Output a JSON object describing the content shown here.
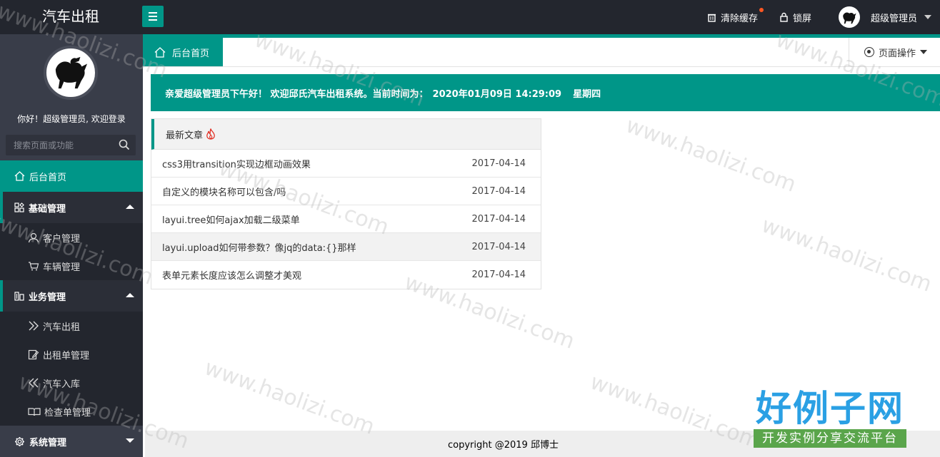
{
  "header": {
    "logo": "汽车出租",
    "clear_cache": "清除缓存",
    "lock_screen": "锁屏",
    "user_name": "超级管理员"
  },
  "sidebar": {
    "greeting": "你好！超级管理员, 欢迎登录",
    "search_placeholder": "搜索页面或功能",
    "home": "后台首页",
    "groups": [
      {
        "label": "基础管理",
        "items": [
          "客户管理",
          "车辆管理"
        ]
      },
      {
        "label": "业务管理",
        "items": [
          "汽车出租",
          "出租单管理",
          "汽车入库",
          "检查单管理"
        ]
      },
      {
        "label": "系统管理"
      }
    ]
  },
  "tabs": {
    "home": "后台首页",
    "page_ops": "页面操作"
  },
  "welcome": {
    "text": "亲爱超级管理员下午好！ 欢迎邱氏汽车出租系统。当前时间为：",
    "time": "2020年01月09日 14:29:09",
    "weekday": "星期四"
  },
  "articles": {
    "title": "最新文章",
    "items": [
      {
        "title": "css3用transition实现边框动画效果",
        "date": "2017-04-14"
      },
      {
        "title": "自定义的模块名称可以包含/吗",
        "date": "2017-04-14"
      },
      {
        "title": "layui.tree如何ajax加载二级菜单",
        "date": "2017-04-14"
      },
      {
        "title": "layui.upload如何带参数？像jq的data:{}那样",
        "date": "2017-04-14"
      },
      {
        "title": "表单元素长度应该怎么调整才美观",
        "date": "2017-04-14"
      }
    ]
  },
  "footer": {
    "copyright": "copyright @2019 邱博士"
  },
  "watermark": {
    "text": "www.haolizi.com",
    "brand_title": "好例子网",
    "brand_sub": "开发实例分享交流平台"
  },
  "colors": {
    "accent": "#009688",
    "topbar": "#23262e",
    "sidebar": "#393d49"
  }
}
